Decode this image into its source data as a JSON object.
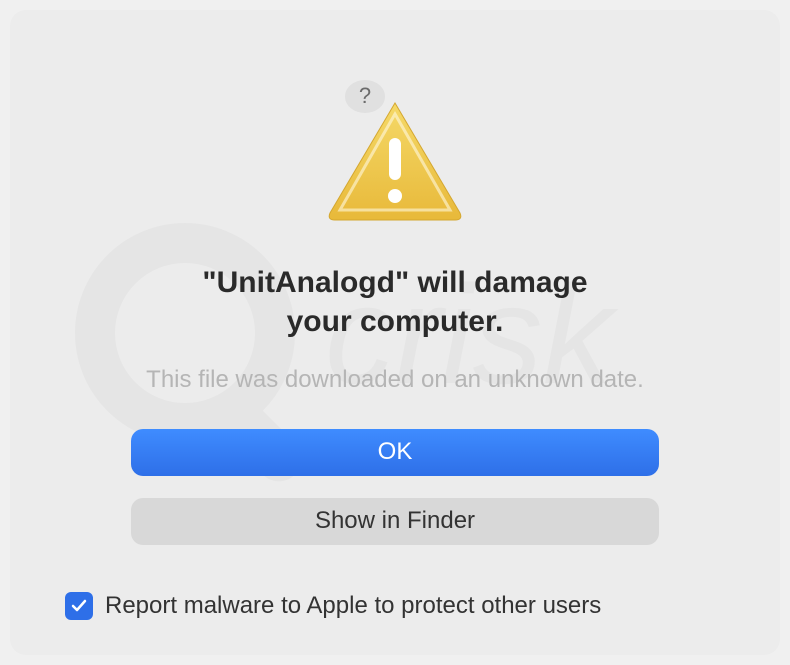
{
  "dialog": {
    "help_label": "?",
    "title_line1": "\"UnitAnalogd\" will damage",
    "title_line2": "your computer.",
    "subtitle": "This file was downloaded on an unknown date.",
    "primary_button": "OK",
    "secondary_button": "Show in Finder",
    "checkbox_label": "Report malware to Apple to protect other users",
    "checkbox_checked": true
  },
  "icons": {
    "warning": "warning-triangle-icon",
    "help": "help-icon",
    "checkmark": "checkmark-icon"
  },
  "watermark": {
    "text": "pcrisk"
  }
}
